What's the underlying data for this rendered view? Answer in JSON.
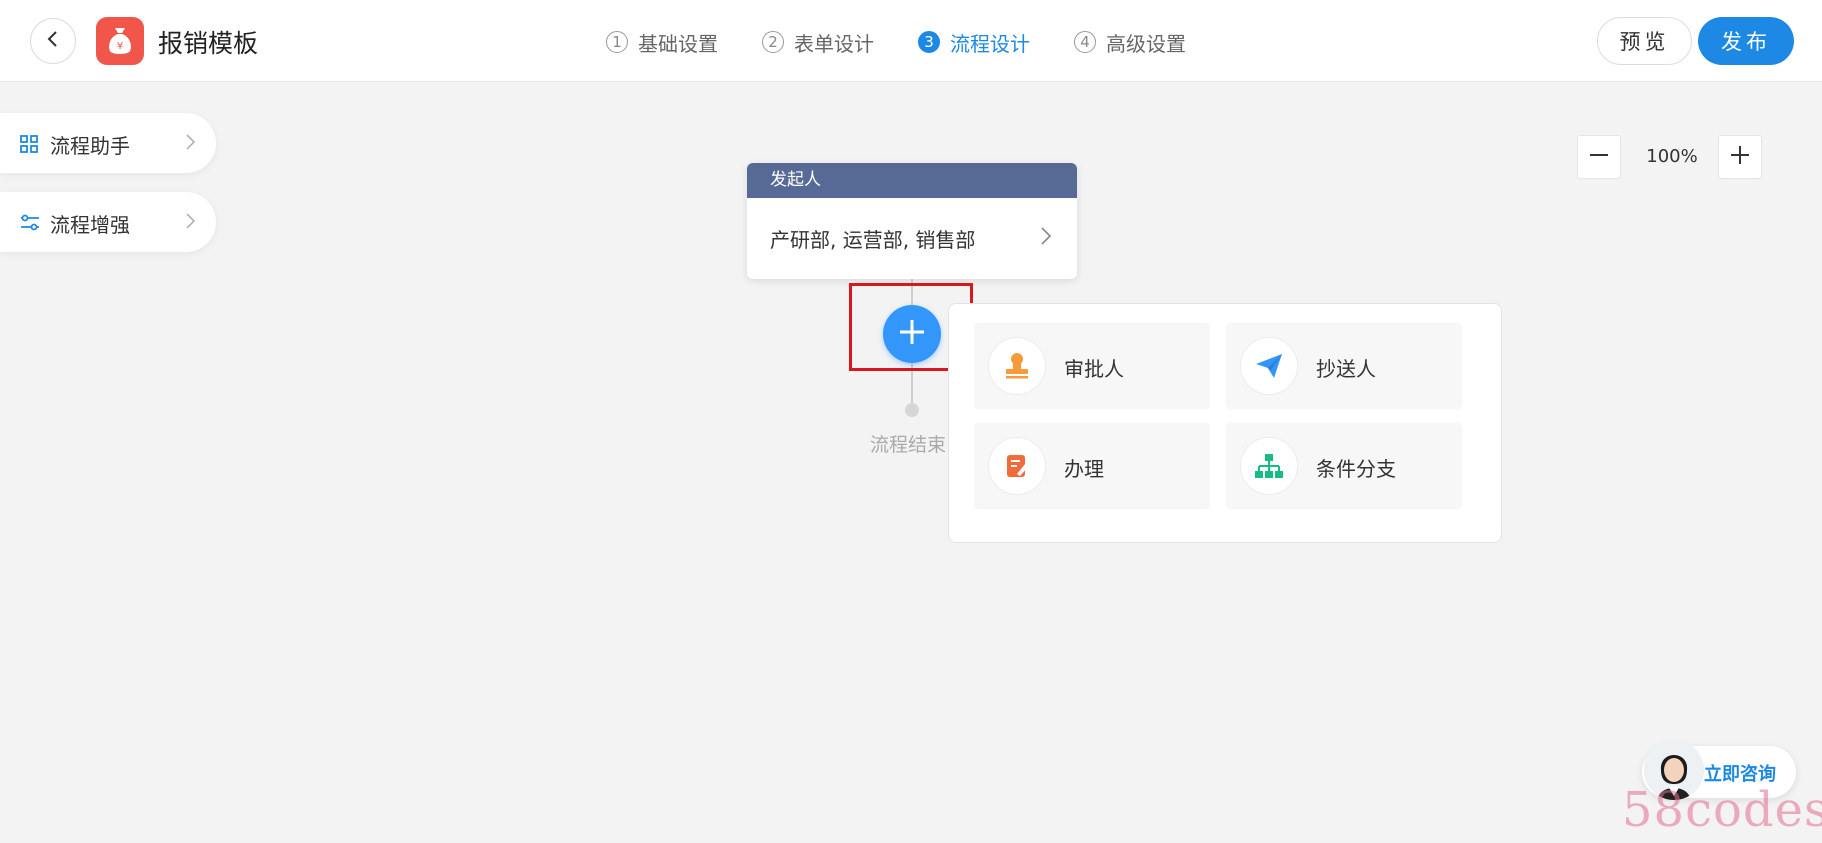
{
  "header": {
    "title": "报销模板",
    "steps": [
      {
        "num": "1",
        "label": "基础设置",
        "active": false
      },
      {
        "num": "2",
        "label": "表单设计",
        "active": false
      },
      {
        "num": "3",
        "label": "流程设计",
        "active": true
      },
      {
        "num": "4",
        "label": "高级设置",
        "active": false
      }
    ],
    "preview_label": "预览",
    "publish_label": "发布"
  },
  "sidebar": {
    "items": [
      {
        "label": "流程助手",
        "icon": "grid-icon"
      },
      {
        "label": "流程增强",
        "icon": "sliders-icon"
      }
    ]
  },
  "zoom": {
    "value": "100%"
  },
  "flow": {
    "start_node": {
      "title": "发起人",
      "value": "产研部, 运营部, 销售部"
    },
    "end_label": "流程结束"
  },
  "add_menu": {
    "options": [
      {
        "label": "审批人",
        "icon": "stamp-icon",
        "color": "#f79a3c"
      },
      {
        "label": "抄送人",
        "icon": "paper-plane-icon",
        "color": "#3296fa"
      },
      {
        "label": "办理",
        "icon": "edit-icon",
        "color": "#f06a3a"
      },
      {
        "label": "条件分支",
        "icon": "branch-icon",
        "color": "#15bc83"
      }
    ]
  },
  "consult": {
    "label": "立即咨询"
  },
  "watermark": {
    "text": "58codes"
  },
  "colors": {
    "primary": "#1e88e5",
    "node_header": "#576a95",
    "app_icon": "#f0574a",
    "highlight": "#d9171e"
  }
}
